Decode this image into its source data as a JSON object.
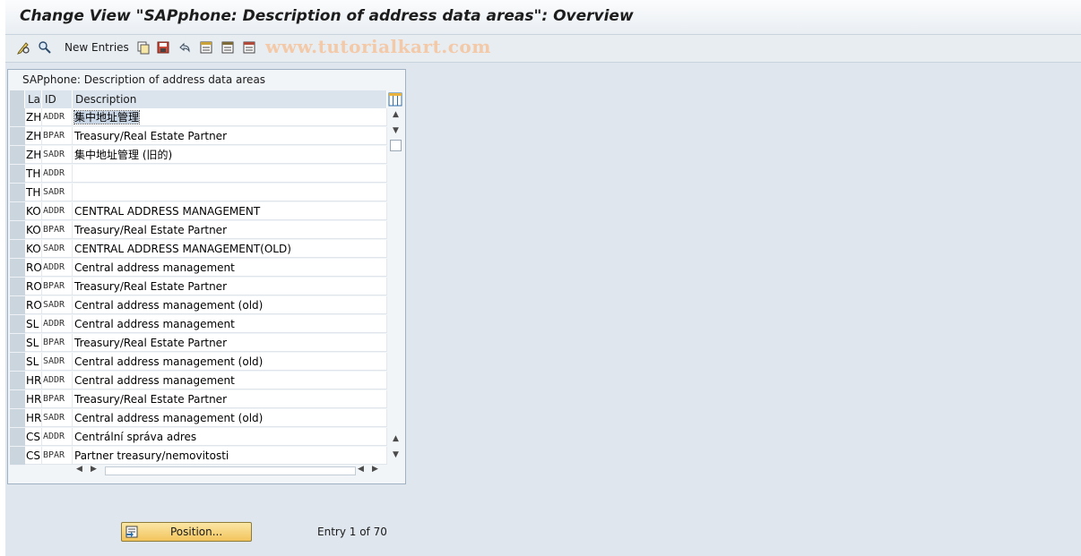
{
  "window": {
    "title": "Change View \"SAPphone: Description of address data areas\": Overview"
  },
  "toolbar": {
    "icons": [
      "edit-pencil-icon",
      "display-glasses-icon",
      "copy-icon",
      "save-as-icon",
      "undo-icon",
      "select-all-icon",
      "deselect-icon",
      "select-block-icon"
    ],
    "new_entries_label": "New Entries"
  },
  "watermark": "www.tutorialkart.com",
  "panel": {
    "title": "SAPphone: Description of address data areas",
    "columns": {
      "la": "La",
      "id": "ID",
      "description": "Description"
    },
    "rows": [
      {
        "la": "ZH",
        "id": "ADDR",
        "description": "集中地址管理"
      },
      {
        "la": "ZH",
        "id": "BPAR",
        "description": "Treasury/Real Estate Partner"
      },
      {
        "la": "ZH",
        "id": "SADR",
        "description": "集中地址管理 (旧的)"
      },
      {
        "la": "TH",
        "id": "ADDR",
        "description": ""
      },
      {
        "la": "TH",
        "id": "SADR",
        "description": ""
      },
      {
        "la": "KO",
        "id": "ADDR",
        "description": "CENTRAL ADDRESS MANAGEMENT"
      },
      {
        "la": "KO",
        "id": "BPAR",
        "description": "Treasury/Real Estate Partner"
      },
      {
        "la": "KO",
        "id": "SADR",
        "description": "CENTRAL ADDRESS MANAGEMENT(OLD)"
      },
      {
        "la": "RO",
        "id": "ADDR",
        "description": "Central address management"
      },
      {
        "la": "RO",
        "id": "BPAR",
        "description": "Treasury/Real Estate Partner"
      },
      {
        "la": "RO",
        "id": "SADR",
        "description": "Central address management (old)"
      },
      {
        "la": "SL",
        "id": "ADDR",
        "description": "Central address management"
      },
      {
        "la": "SL",
        "id": "BPAR",
        "description": "Treasury/Real Estate Partner"
      },
      {
        "la": "SL",
        "id": "SADR",
        "description": "Central address management (old)"
      },
      {
        "la": "HR",
        "id": "ADDR",
        "description": "Central address management"
      },
      {
        "la": "HR",
        "id": "BPAR",
        "description": "Treasury/Real Estate Partner"
      },
      {
        "la": "HR",
        "id": "SADR",
        "description": "Central address management (old)"
      },
      {
        "la": "CS",
        "id": "ADDR",
        "description": "Centrální správa adres"
      },
      {
        "la": "CS",
        "id": "BPAR",
        "description": "Partner treasury/nemovitosti"
      }
    ]
  },
  "footer": {
    "position_button_label": "Position...",
    "entry_text": "Entry 1 of 70"
  }
}
